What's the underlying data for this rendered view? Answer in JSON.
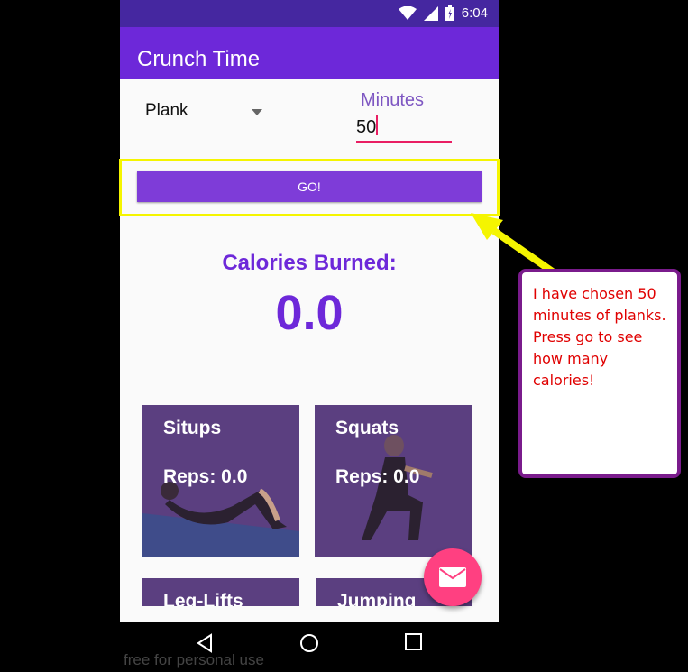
{
  "status_bar": {
    "time": "6:04"
  },
  "app": {
    "title": "Crunch Time"
  },
  "form": {
    "exercise_selected": "Plank",
    "minutes_label": "Minutes",
    "minutes_value": "50",
    "go_label": "GO!"
  },
  "result": {
    "label": "Calories Burned:",
    "value": "0.0"
  },
  "cards": [
    {
      "name": "Situps",
      "reps": "Reps: 0.0"
    },
    {
      "name": "Squats",
      "reps": "Reps: 0.0"
    },
    {
      "name": "Leg-Lifts"
    },
    {
      "name": "Jumping"
    }
  ],
  "watermark": "free for personal use",
  "annotation": {
    "text": "I have chosen 50 minutes of planks. Press go to see how many calories!",
    "highlight_color": "#f5f500",
    "border_color": "#7a1b8c",
    "text_color": "#e00000"
  },
  "colors": {
    "status_bar": "#4527a0",
    "app_bar": "#6d28d9",
    "accent": "#7e3cd8",
    "fab": "#ff4081",
    "card": "#5b3f80"
  },
  "icons": [
    "wifi-icon",
    "signal-icon",
    "battery-icon",
    "dropdown-arrow-icon",
    "email-icon",
    "nav-back-icon",
    "nav-home-icon",
    "nav-recents-icon"
  ]
}
